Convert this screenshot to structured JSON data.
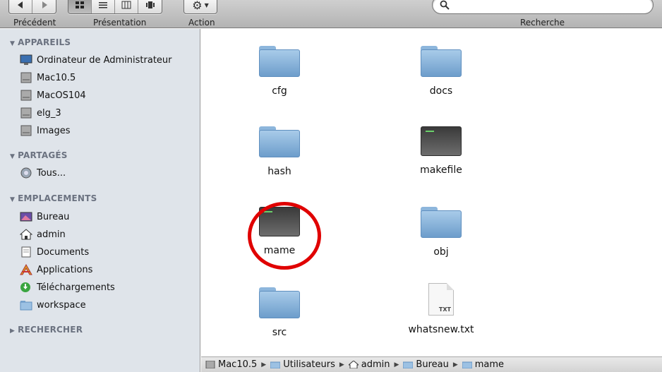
{
  "toolbar": {
    "back_label": "Précédent",
    "view_label": "Présentation",
    "action_label": "Action",
    "search_label": "Recherche"
  },
  "sidebar": {
    "sections": [
      {
        "title": "APPAREILS",
        "items": [
          "Ordinateur de Administrateur",
          "Mac10.5",
          "MacOS104",
          "elg_3",
          "Images"
        ]
      },
      {
        "title": "PARTAGÉS",
        "items": [
          "Tous..."
        ]
      },
      {
        "title": "EMPLACEMENTS",
        "items": [
          "Bureau",
          "admin",
          "Documents",
          "Applications",
          "Téléchargements",
          "workspace"
        ]
      },
      {
        "title": "RECHERCHER",
        "items": []
      }
    ]
  },
  "files": [
    {
      "name": "cfg",
      "icon": "folder-icon"
    },
    {
      "name": "docs",
      "icon": "folder-icon"
    },
    {
      "name": "hash",
      "icon": "folder-icon"
    },
    {
      "name": "makefile",
      "icon": "terminal-exec-icon"
    },
    {
      "name": "mame",
      "icon": "terminal-exec-icon",
      "highlighted": true
    },
    {
      "name": "obj",
      "icon": "folder-icon"
    },
    {
      "name": "src",
      "icon": "folder-icon"
    },
    {
      "name": "whatsnew.txt",
      "icon": "txt-document-icon"
    }
  ],
  "txt_badge": "TXT",
  "pathbar": [
    "Mac10.5",
    "Utilisateurs",
    "admin",
    "Bureau",
    "mame"
  ],
  "colors": {
    "highlight_circle": "#e00000",
    "sidebar_bg": "#dfe4ea",
    "folder_blue": "#8db6dc"
  }
}
